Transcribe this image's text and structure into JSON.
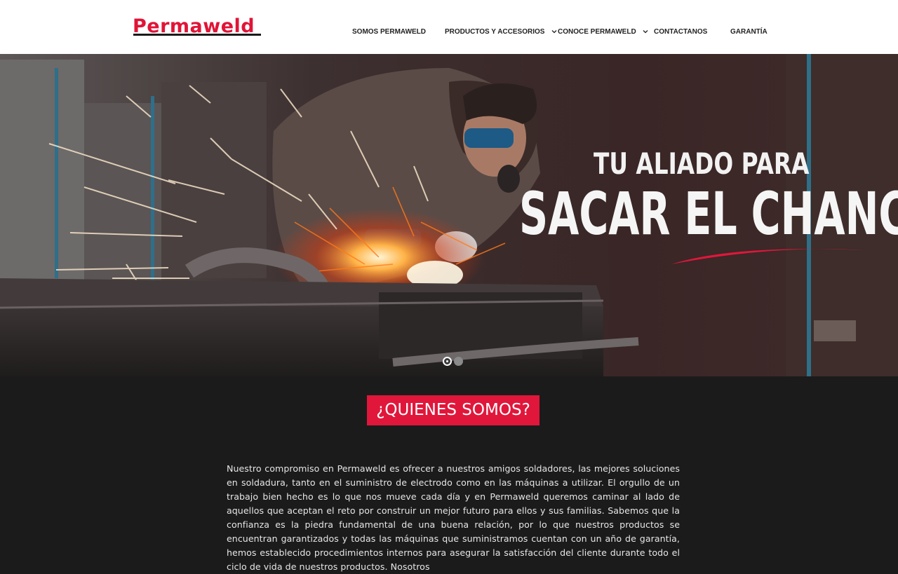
{
  "brand": {
    "logo_text": "Permaweld",
    "accent": "#e0173b"
  },
  "nav": {
    "items": [
      {
        "label": "SOMOS PERMAWELD",
        "has_dropdown": false
      },
      {
        "label": "PRODUCTOS Y ACCESORIOS",
        "has_dropdown": true
      },
      {
        "label": "CONOCE PERMAWELD",
        "has_dropdown": true
      },
      {
        "label": "CONTACTANOS",
        "has_dropdown": false
      },
      {
        "label": "GARANTÍA",
        "has_dropdown": false
      }
    ],
    "dropdown_icon": "chevron-down-icon"
  },
  "hero": {
    "headline_small": "TU ALIADO PARA",
    "headline_large": "SACAR EL CHANCE",
    "slides_total": 2,
    "active_slide": 1
  },
  "about": {
    "title": "¿QUIENES SOMOS?",
    "body": "Nuestro compromiso en Permaweld es ofrecer a nuestros amigos soldadores, las mejores soluciones en soldadura, tanto en el suministro de electrodo como en las máquinas a utilizar. El orgullo de un trabajo bien hecho es lo que nos mueve cada día y en Permaweld queremos caminar al lado de aquellos que aceptan el reto por construir un mejor futuro para ellos y sus familias. Sabemos que la confianza es la piedra fundamental de una buena relación, por lo que nuestros productos se encuentran garantizados y todas las máquinas que suministramos cuentan con un año de garantía, hemos establecido procedimientos internos para asegurar la satisfacción del cliente durante todo el ciclo de vida de nuestros productos. Nosotros"
  }
}
